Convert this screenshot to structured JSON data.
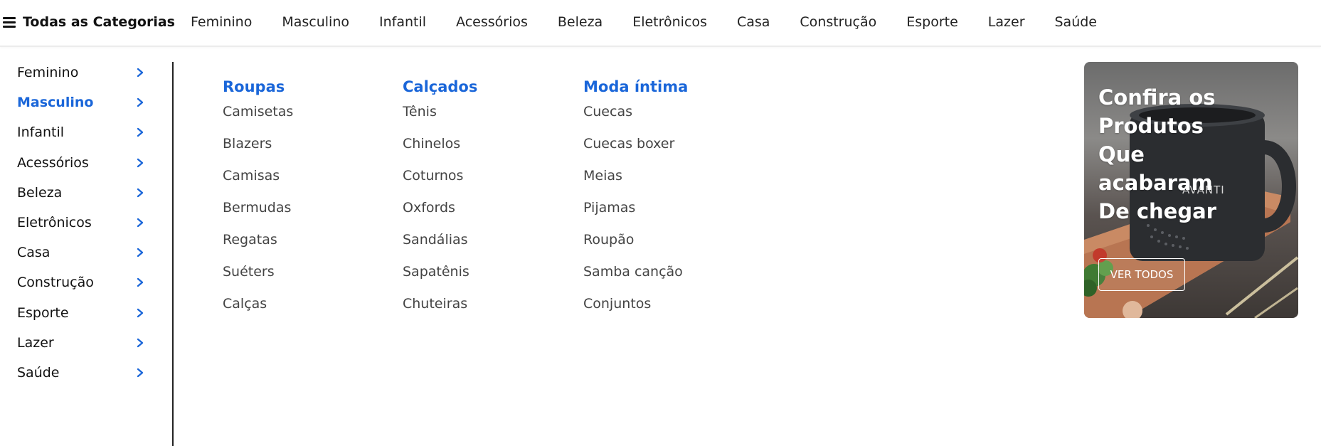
{
  "header": {
    "all_categories_label": "Todas as Categorias",
    "nav": [
      "Feminino",
      "Masculino",
      "Infantil",
      "Acessórios",
      "Beleza",
      "Eletrônicos",
      "Casa",
      "Construção",
      "Esporte",
      "Lazer",
      "Saúde"
    ]
  },
  "sidebar": {
    "items": [
      {
        "label": "Feminino",
        "active": false
      },
      {
        "label": "Masculino",
        "active": true
      },
      {
        "label": "Infantil",
        "active": false
      },
      {
        "label": "Acessórios",
        "active": false
      },
      {
        "label": "Beleza",
        "active": false
      },
      {
        "label": "Eletrônicos",
        "active": false
      },
      {
        "label": "Casa",
        "active": false
      },
      {
        "label": "Construção",
        "active": false
      },
      {
        "label": "Esporte",
        "active": false
      },
      {
        "label": "Lazer",
        "active": false
      },
      {
        "label": "Saúde",
        "active": false
      }
    ],
    "chevron_icon": "chevron-right-icon"
  },
  "columns": [
    {
      "title": "Roupas",
      "links": [
        "Camisetas",
        "Blazers",
        "Camisas",
        "Bermudas",
        "Regatas",
        "Suéters",
        "Calças"
      ]
    },
    {
      "title": "Calçados",
      "links": [
        "Tênis",
        "Chinelos",
        "Coturnos",
        "Oxfords",
        "Sandálias",
        "Sapatênis",
        "Chuteiras"
      ]
    },
    {
      "title": "Moda íntima",
      "links": [
        "Cuecas",
        "Cuecas boxer",
        "Meias",
        "Pijamas",
        "Roupão",
        "Samba canção",
        "Conjuntos"
      ]
    }
  ],
  "banner": {
    "title": "Confira os Produtos Que acabaram De chegar",
    "button_label": "VER TODOS",
    "mug_brand": "AVANTI"
  },
  "colors": {
    "accent": "#1a66d9",
    "text": "#222222",
    "muted": "#444444"
  }
}
